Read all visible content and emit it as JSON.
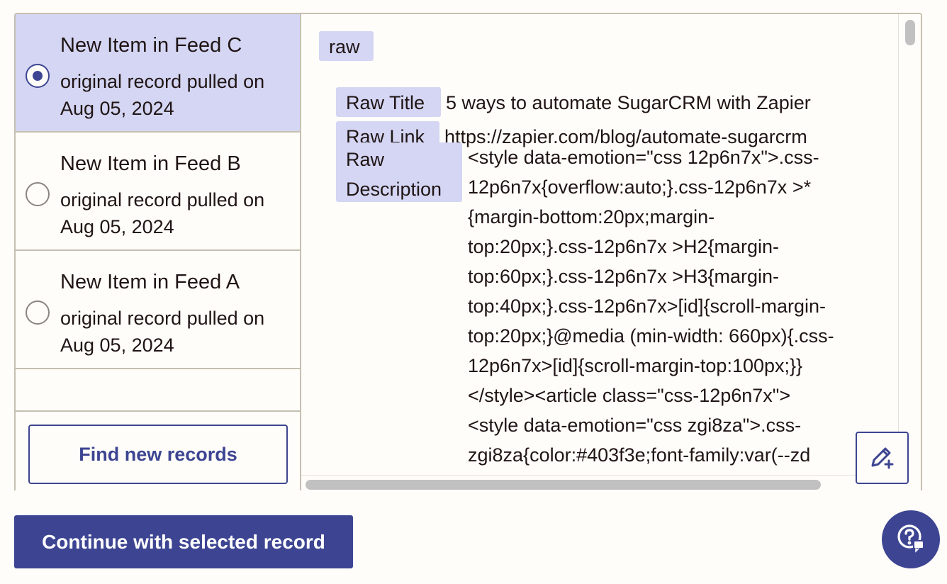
{
  "records": [
    {
      "title": "New Item in Feed C",
      "subtitle": "original record pulled on Aug 05, 2024",
      "selected": true
    },
    {
      "title": "New Item in Feed B",
      "subtitle": "original record pulled on Aug 05, 2024",
      "selected": false
    },
    {
      "title": "New Item in Feed A",
      "subtitle": "original record pulled on Aug 05, 2024",
      "selected": false
    }
  ],
  "find_button_label": "Find new records",
  "detail": {
    "group_label": "raw",
    "fields": [
      {
        "label": "Raw Title",
        "value": "5 ways to automate SugarCRM with Zapier"
      },
      {
        "label": "Raw Link",
        "value": "https://zapier.com/blog/automate-sugarcrm"
      }
    ],
    "description_label": "Raw Description",
    "description_value": "<style data-emotion=\"css 12p6n7x\">.css-\n12p6n7x{overflow:auto;}.css-12p6n7x >*\n{margin-bottom:20px;margin-\ntop:20px;}.css-12p6n7x >H2{margin-\ntop:60px;}.css-12p6n7x >H3{margin-\ntop:40px;}.css-12p6n7x>[id]{scroll-margin-\ntop:20px;}@media (min-width: 660px){.css-\n12p6n7x>[id]{scroll-margin-top:100px;}}\n</style><article class=\"css-12p6n7x\">\n<style data-emotion=\"css zgi8za\">.css-\nzgi8za{color:#403f3e;font-family:var(--zd"
  },
  "continue_button_label": "Continue with selected record",
  "icons": {
    "edit": "edit-plus-icon",
    "help": "help-chat-icon"
  },
  "colors": {
    "accent": "#3d4592",
    "selected_bg": "#d4d6f3",
    "chip_bg": "#d4d6f3",
    "border": "#c5c0b1"
  }
}
